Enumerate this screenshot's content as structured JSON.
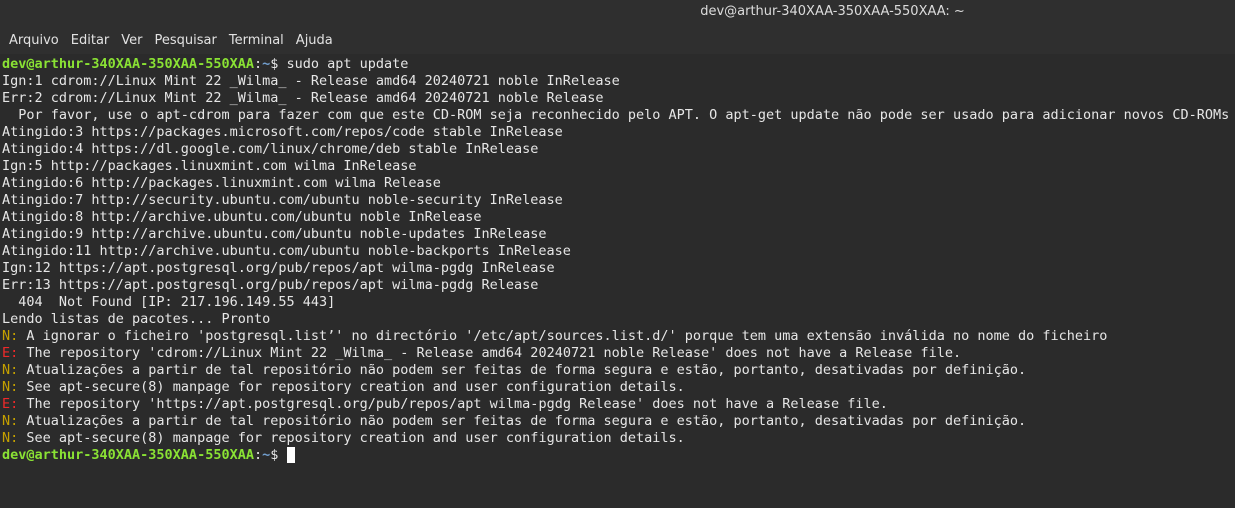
{
  "window": {
    "title": "dev@arthur-340XAA-350XAA-550XAA: ~"
  },
  "menu": [
    {
      "label": "Arquivo"
    },
    {
      "label": "Editar"
    },
    {
      "label": "Ver"
    },
    {
      "label": "Pesquisar"
    },
    {
      "label": "Terminal"
    },
    {
      "label": "Ajuda"
    }
  ],
  "prompt": {
    "user_host": "dev@arthur-340XAA-350XAA-550XAA",
    "path": "~",
    "symbol": "$ "
  },
  "command": "sudo apt update",
  "output": [
    "Ign:1 cdrom://Linux Mint 22 _Wilma_ - Release amd64 20240721 noble InRelease",
    "Err:2 cdrom://Linux Mint 22 _Wilma_ - Release amd64 20240721 noble Release",
    "  Por favor, use o apt-cdrom para fazer com que este CD-ROM seja reconhecido pelo APT. O apt-get update não pode ser usado para adicionar novos CD-ROMs",
    "Atingido:3 https://packages.microsoft.com/repos/code stable InRelease",
    "Atingido:4 https://dl.google.com/linux/chrome/deb stable InRelease",
    "Ign:5 http://packages.linuxmint.com wilma InRelease",
    "Atingido:6 http://packages.linuxmint.com wilma Release",
    "Atingido:7 http://security.ubuntu.com/ubuntu noble-security InRelease",
    "Atingido:8 http://archive.ubuntu.com/ubuntu noble InRelease",
    "Atingido:9 http://archive.ubuntu.com/ubuntu noble-updates InRelease",
    "Atingido:11 http://archive.ubuntu.com/ubuntu noble-backports InRelease",
    "Ign:12 https://apt.postgresql.org/pub/repos/apt wilma-pgdg InRelease",
    "Err:13 https://apt.postgresql.org/pub/repos/apt wilma-pgdg Release",
    "  404  Not Found [IP: 217.196.149.55 443]",
    "Lendo listas de pacotes... Pronto"
  ],
  "messages": [
    {
      "tag": "N:",
      "level": "n",
      "text": " A ignorar o ficheiro 'postgresql.list’' no directório '/etc/apt/sources.list.d/' porque tem uma extensão inválida no nome do ficheiro"
    },
    {
      "tag": "E:",
      "level": "e",
      "text": " The repository 'cdrom://Linux Mint 22 _Wilma_ - Release amd64 20240721 noble Release' does not have a Release file."
    },
    {
      "tag": "N:",
      "level": "n",
      "text": " Atualizações a partir de tal repositório não podem ser feitas de forma segura e estão, portanto, desativadas por definição."
    },
    {
      "tag": "N:",
      "level": "n",
      "text": " See apt-secure(8) manpage for repository creation and user configuration details."
    },
    {
      "tag": "E:",
      "level": "e",
      "text": " The repository 'https://apt.postgresql.org/pub/repos/apt wilma-pgdg Release' does not have a Release file."
    },
    {
      "tag": "N:",
      "level": "n",
      "text": " Atualizações a partir de tal repositório não podem ser feitas de forma segura e estão, portanto, desativadas por definição."
    },
    {
      "tag": "N:",
      "level": "n",
      "text": " See apt-secure(8) manpage for repository creation and user configuration details."
    }
  ],
  "colors": {
    "background": "#2b2b2b",
    "prompt_user": "#8ae234",
    "prompt_path": "#729fcf",
    "notice": "#c4a000",
    "error": "#ef2929"
  }
}
